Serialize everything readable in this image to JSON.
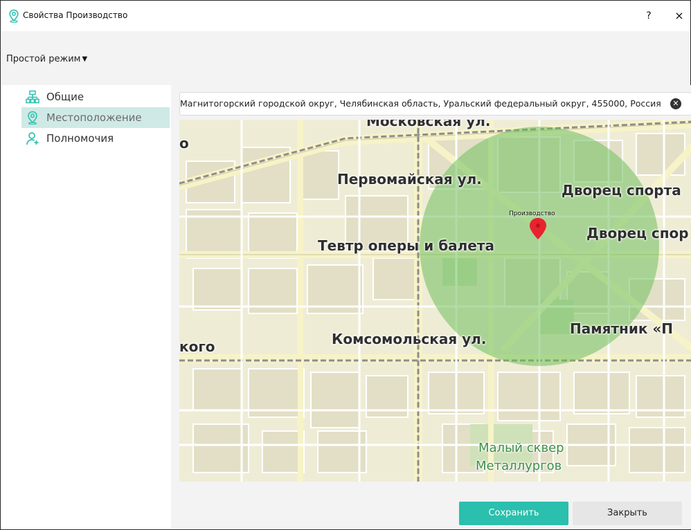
{
  "window": {
    "title": "Свойства Производство",
    "help_label": "?",
    "close_label": "×",
    "icon": "location-pin-icon"
  },
  "mode": {
    "label": "Простой режим",
    "caret": "▼"
  },
  "sidebar": {
    "items": [
      {
        "label": "Общие",
        "icon": "org-structure-icon",
        "active": false
      },
      {
        "label": "Местоположение",
        "icon": "location-pin-icon",
        "active": true
      },
      {
        "label": "Полномочия",
        "icon": "user-add-icon",
        "active": false
      }
    ]
  },
  "search": {
    "value": "Магнитогорский городской округ, Челябинская область, Уральский федеральный округ, 455000, Россия",
    "clear_icon": "clear-circle-icon"
  },
  "map": {
    "labels": {
      "street_moskovskaya": "Московская ул.",
      "street_pervomayskaya": "Первомайская ул.",
      "theatre": "Тевтр оперы и балета",
      "street_komsomolskaya": "Комсомольская ул.",
      "palace_sports_1": "Дворец спорта",
      "palace_sports_2": "Дворец спор",
      "monument": "Памятник «П",
      "left_edge_top": "о",
      "left_edge_mid": "кого",
      "square_1": "Малый сквер",
      "square_2": "Металлургов"
    },
    "marker": {
      "caption": "Производство",
      "color": "#e8232f"
    },
    "radius_color": "#6fbf5e"
  },
  "footer": {
    "save_label": "Сохранить",
    "close_label": "Закрыть"
  },
  "colors": {
    "accent": "#2bbfad",
    "active_item_bg": "#cfe9e6"
  }
}
